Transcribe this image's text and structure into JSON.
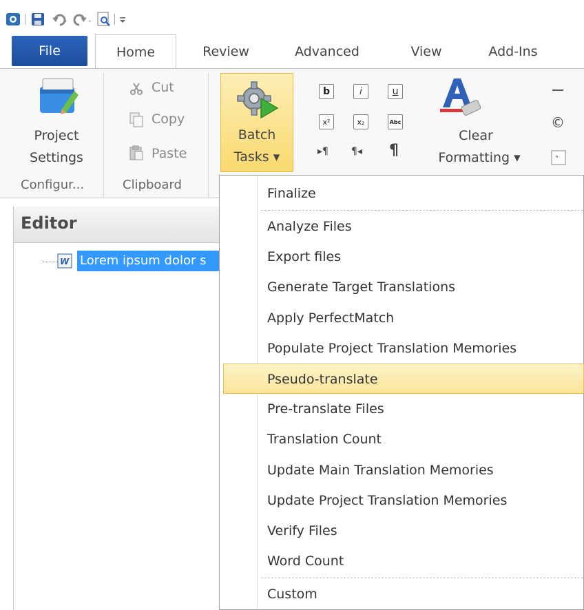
{
  "quick_access": {
    "icons": [
      "app-icon",
      "save-icon",
      "undo-icon",
      "redo-icon",
      "print-preview-icon",
      "customize-icon"
    ]
  },
  "tabs": [
    {
      "label": "File"
    },
    {
      "label": "Home"
    },
    {
      "label": "Review"
    },
    {
      "label": "Advanced"
    },
    {
      "label": "View"
    },
    {
      "label": "Add-Ins"
    }
  ],
  "ribbon": {
    "configuration": {
      "button_line1": "Project",
      "button_line2": "Settings",
      "group_label": "Configur..."
    },
    "clipboard": {
      "cut": "Cut",
      "copy": "Copy",
      "paste": "Paste",
      "group_label": "Clipboard"
    },
    "batch": {
      "line1": "Batch",
      "line2": "Tasks ▾"
    },
    "formatting": {
      "buttons": [
        "b",
        "i",
        "u",
        "x²",
        "x₂",
        "Abc",
        "▸¶",
        "¶◂",
        "¶"
      ],
      "clear_line1": "Clear",
      "clear_line2": "Formatting ▾"
    },
    "insert": {
      "copyright": "©"
    }
  },
  "editor": {
    "title": "Editor",
    "item_label": "Lorem ipsum dolor s"
  },
  "menu": {
    "items": [
      {
        "label": "Finalize"
      },
      {
        "label": "Analyze Files"
      },
      {
        "label": "Export files"
      },
      {
        "label": "Generate Target Translations"
      },
      {
        "label": "Apply PerfectMatch"
      },
      {
        "label": "Populate Project Translation Memories"
      },
      {
        "label": "Pseudo-translate"
      },
      {
        "label": "Pre-translate Files"
      },
      {
        "label": "Translation Count"
      },
      {
        "label": "Update Main Translation Memories"
      },
      {
        "label": "Update Project Translation Memories"
      },
      {
        "label": "Verify Files"
      },
      {
        "label": "Word Count"
      },
      {
        "label": "Custom"
      }
    ],
    "highlighted": "Pseudo-translate"
  },
  "colors": {
    "file_tab": "#2b64bd",
    "selection": "#3399ff",
    "hover": "#fbe59a"
  }
}
